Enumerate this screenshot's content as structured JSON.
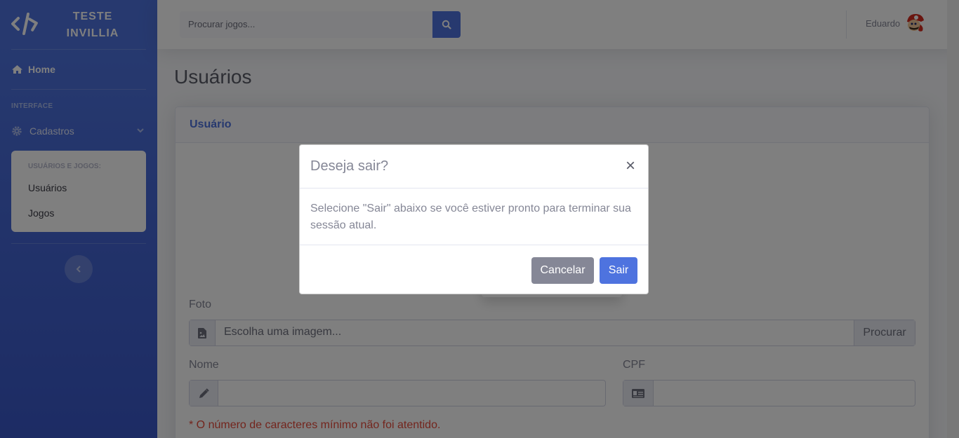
{
  "brand": {
    "line1": "TESTE",
    "line2": "INVILLIA"
  },
  "sidebar": {
    "home_label": "Home",
    "heading": "INTERFACE",
    "cadastros_label": "Cadastros",
    "collapse": {
      "header": "USUÁRIOS E JOGOS:",
      "items": [
        {
          "label": "Usuários"
        },
        {
          "label": "Jogos"
        }
      ]
    }
  },
  "topbar": {
    "search_placeholder": "Procurar jogos...",
    "user_name": "Eduardo"
  },
  "page": {
    "title": "Usuários",
    "card_title": "Usuário",
    "foto_label": "Foto",
    "foto_placeholder": "Escolha uma imagem...",
    "foto_button": "Procurar",
    "nome_label": "Nome",
    "cpf_label": "CPF",
    "error_message": "* O número de caracteres mínimo não foi atentido."
  },
  "modal": {
    "title": "Deseja sair?",
    "close_symbol": "×",
    "body": "Selecione \"Sair\" abaixo se você estiver pronto para terminar sua sessão atual.",
    "cancel_label": "Cancelar",
    "confirm_label": "Sair"
  },
  "colors": {
    "primary": "#4e73df",
    "secondary": "#858796",
    "danger": "#e74a3b"
  }
}
